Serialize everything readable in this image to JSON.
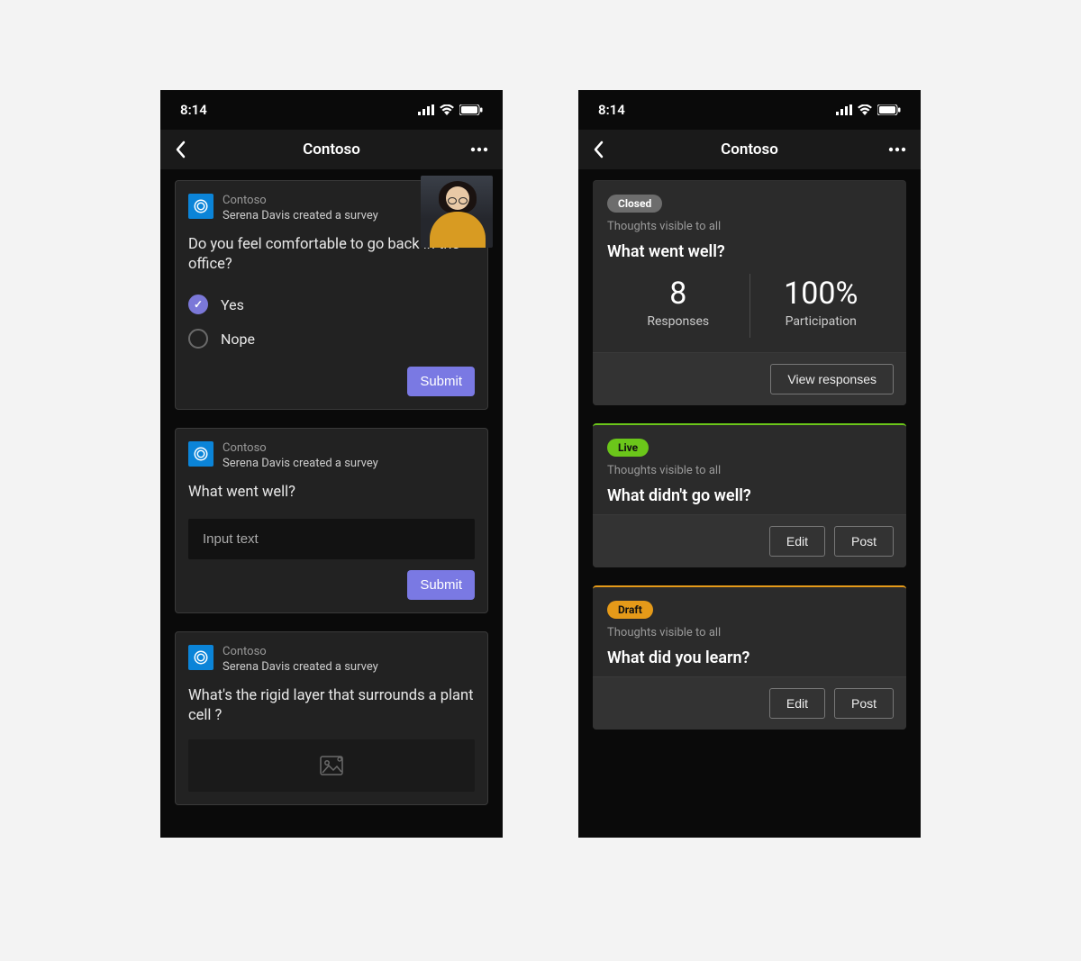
{
  "status_bar": {
    "time": "8:14"
  },
  "nav": {
    "title": "Contoso"
  },
  "left": {
    "cards": [
      {
        "app": "Contoso",
        "subtitle": "Serena Davis created a survey",
        "question": "Do you feel comfortable to go back in the office?",
        "options": [
          "Yes",
          "Nope"
        ],
        "selected_index": 0,
        "submit": "Submit"
      },
      {
        "app": "Contoso",
        "subtitle": "Serena Davis created a survey",
        "question": "What went well?",
        "placeholder": "Input text",
        "submit": "Submit"
      },
      {
        "app": "Contoso",
        "subtitle": "Serena Davis created a survey",
        "question": "What's the rigid layer that surrounds a plant cell ?"
      }
    ]
  },
  "right": {
    "cards": [
      {
        "status": "Closed",
        "visibility": "Thoughts visible to all",
        "title": "What went well?",
        "metrics": [
          {
            "value": "8",
            "label": "Responses"
          },
          {
            "value": "100%",
            "label": "Participation"
          }
        ],
        "action": "View responses"
      },
      {
        "status": "Live",
        "visibility": "Thoughts visible to all",
        "title": "What didn't go well?",
        "actions": [
          "Edit",
          "Post"
        ]
      },
      {
        "status": "Draft",
        "visibility": "Thoughts visible to all",
        "title": "What did you learn?",
        "actions": [
          "Edit",
          "Post"
        ]
      }
    ]
  }
}
